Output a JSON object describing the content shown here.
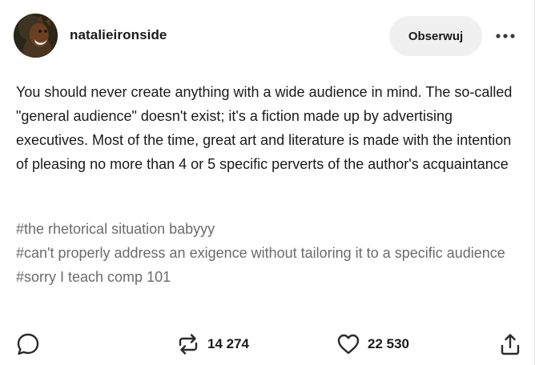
{
  "post": {
    "author": {
      "username": "natalieironside"
    },
    "follow_label": "Obserwuj",
    "more_icon": "ellipsis-icon",
    "body": "You should never create anything with a wide audience in mind.  The so-called \"general audience\" doesn't exist; it's a fiction made up by advertising executives.  Most of the time, great art and literature is made with the intention of pleasing no more than 4 or 5 specific perverts of the author's acquaintance",
    "tags": [
      "#the rhetorical situation babyyy",
      "#can't properly address an exigence without tailoring it to a specific audience",
      "#sorry I teach comp 101"
    ]
  },
  "footer": {
    "reply_icon": "speech-bubble-icon",
    "reblog_icon": "reblog-icon",
    "reblog_count": "14 274",
    "like_icon": "heart-icon",
    "like_count": "22 530",
    "share_icon": "share-icon"
  }
}
